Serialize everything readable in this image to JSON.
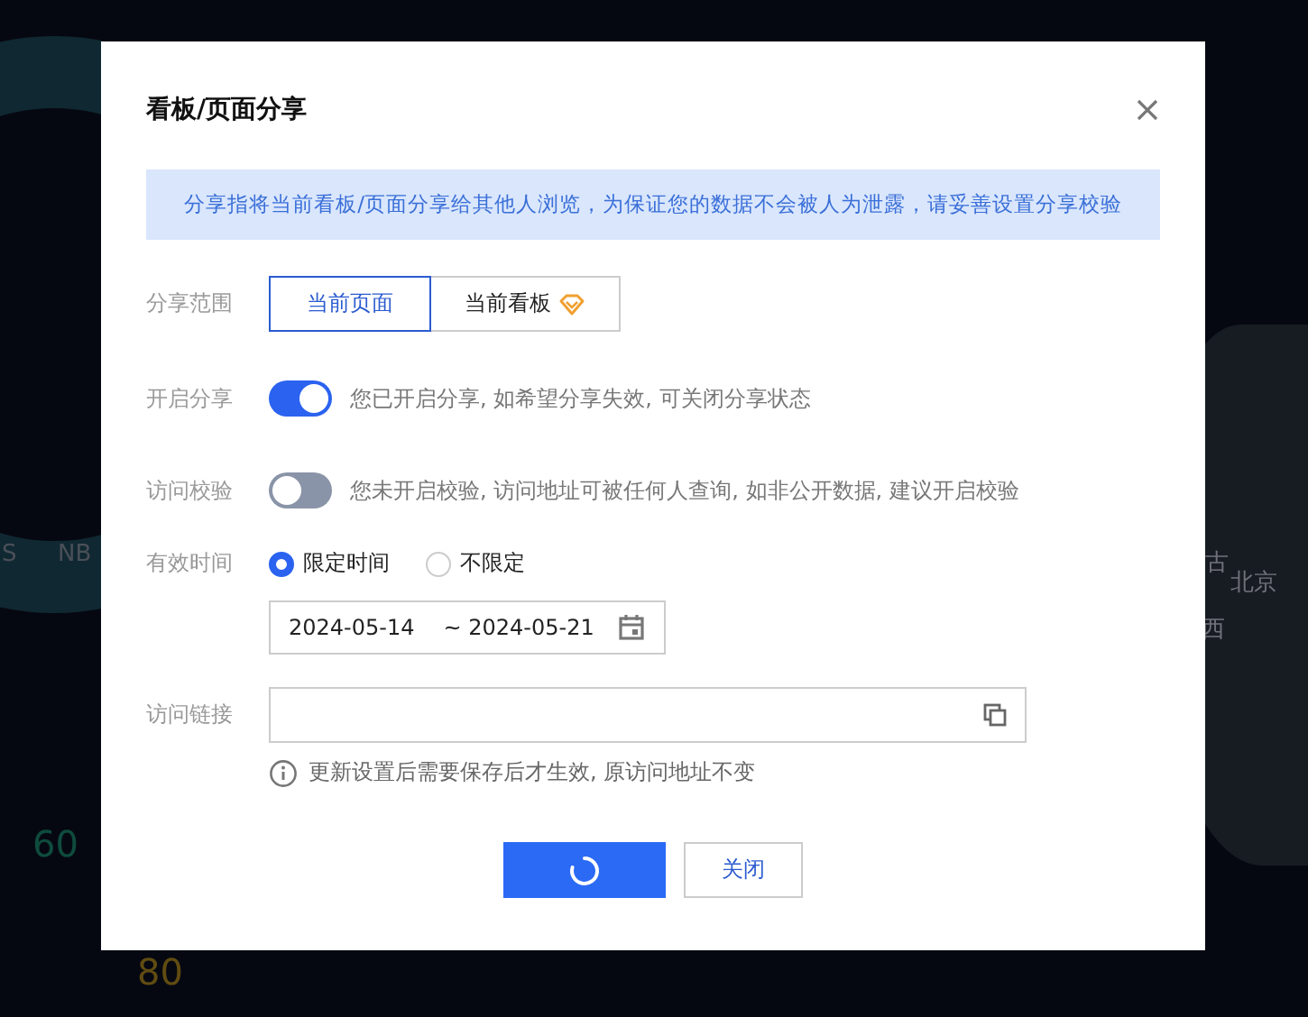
{
  "backdrop": {
    "labels": [
      {
        "text": "S",
        "kind": "legend"
      },
      {
        "text": "NB",
        "kind": "legend"
      },
      {
        "text": "60",
        "kind": "gauge"
      },
      {
        "text": "80",
        "kind": "gauge-warn"
      },
      {
        "text": "古",
        "kind": "map"
      },
      {
        "text": "北京",
        "kind": "map"
      },
      {
        "text": "西",
        "kind": "map"
      }
    ]
  },
  "dialog": {
    "title": "看板/页面分享",
    "notice": "分享指将当前看板/页面分享给其他人浏览，为保证您的数据不会被人为泄露，请妥善设置分享校验",
    "fields": [
      {
        "kind": "segmented",
        "label": "分享范围",
        "options": [
          {
            "label": "当前页面",
            "selected": true,
            "premium": false
          },
          {
            "label": "当前看板",
            "selected": false,
            "premium": true
          }
        ]
      },
      {
        "kind": "switch",
        "label": "开启分享",
        "on": true,
        "description": "您已开启分享, 如希望分享失效, 可关闭分享状态"
      },
      {
        "kind": "switch",
        "label": "访问校验",
        "on": false,
        "description": "您未开启校验, 访问地址可被任何人查询, 如非公开数据, 建议开启校验"
      },
      {
        "kind": "radio",
        "label": "有效时间",
        "options": [
          {
            "label": "限定时间",
            "selected": true
          },
          {
            "label": "不限定",
            "selected": false
          }
        ],
        "date_range": {
          "start": "2024-05-14",
          "separator": "~",
          "end": "2024-05-21"
        }
      },
      {
        "kind": "link",
        "label": "访问链接",
        "hint": "更新设置后需要保存后才生效, 原访问地址不变"
      }
    ],
    "buttons": [
      {
        "kind": "primary",
        "loading": true
      },
      {
        "kind": "default",
        "label": "关闭"
      }
    ]
  }
}
